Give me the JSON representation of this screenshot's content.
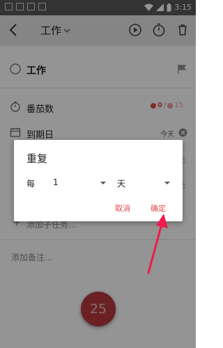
{
  "status_bar": {
    "time": "3:15"
  },
  "toolbar": {
    "title": "工作"
  },
  "task": {
    "name": "工作"
  },
  "pomodoro": {
    "label": "番茄数",
    "done": "0",
    "separator": "/",
    "total": "15"
  },
  "due_date": {
    "label": "到期日",
    "value": "今天"
  },
  "obscured": {
    "row1_end": "无",
    "row2_end": "无"
  },
  "subtask": {
    "placeholder": "添加子任务..."
  },
  "notes": {
    "placeholder": "添加备注..."
  },
  "fab": {
    "label": "25"
  },
  "dialog": {
    "title": "重复",
    "every_label": "每",
    "count_value": "1",
    "unit_value": "天",
    "cancel_label": "取消",
    "confirm_label": "确定"
  },
  "colors": {
    "accent": "#e24a4a",
    "fab": "#b93a3f",
    "annotation_arrow": "#ee1b4b"
  }
}
